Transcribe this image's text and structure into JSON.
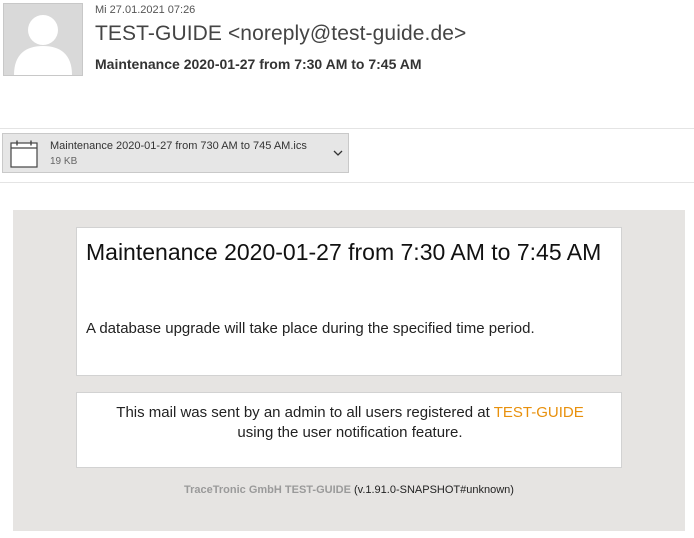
{
  "header": {
    "date": "Mi 27.01.2021 07:26",
    "sender": "TEST-GUIDE <noreply@test-guide.de>",
    "subject": "Maintenance 2020-01-27 from 7:30 AM to 7:45 AM"
  },
  "avatar": {
    "icon": "person-placeholder-icon"
  },
  "attachment": {
    "filename": "Maintenance 2020-01-27 from 730 AM to 745 AM.ics",
    "size": "19 KB",
    "icon": "calendar-icon",
    "menu_icon": "chevron-down-icon"
  },
  "content": {
    "title": "Maintenance 2020-01-27 from 7:30 AM to 7:45 AM",
    "body": "A database upgrade will take place during the specified time period.",
    "notice_prefix": "This mail was sent by an admin to all users registered at",
    "notice_link": "TEST-GUIDE",
    "notice_suffix": "using the user notification feature.",
    "footer_org": "TraceTronic GmbH TEST-GUIDE",
    "footer_version": "(v.1.91.0-SNAPSHOT#unknown)"
  },
  "colors": {
    "link": "#e8900c",
    "content_background": "#e6e4e2",
    "attachment_background": "#e6e6e6"
  }
}
